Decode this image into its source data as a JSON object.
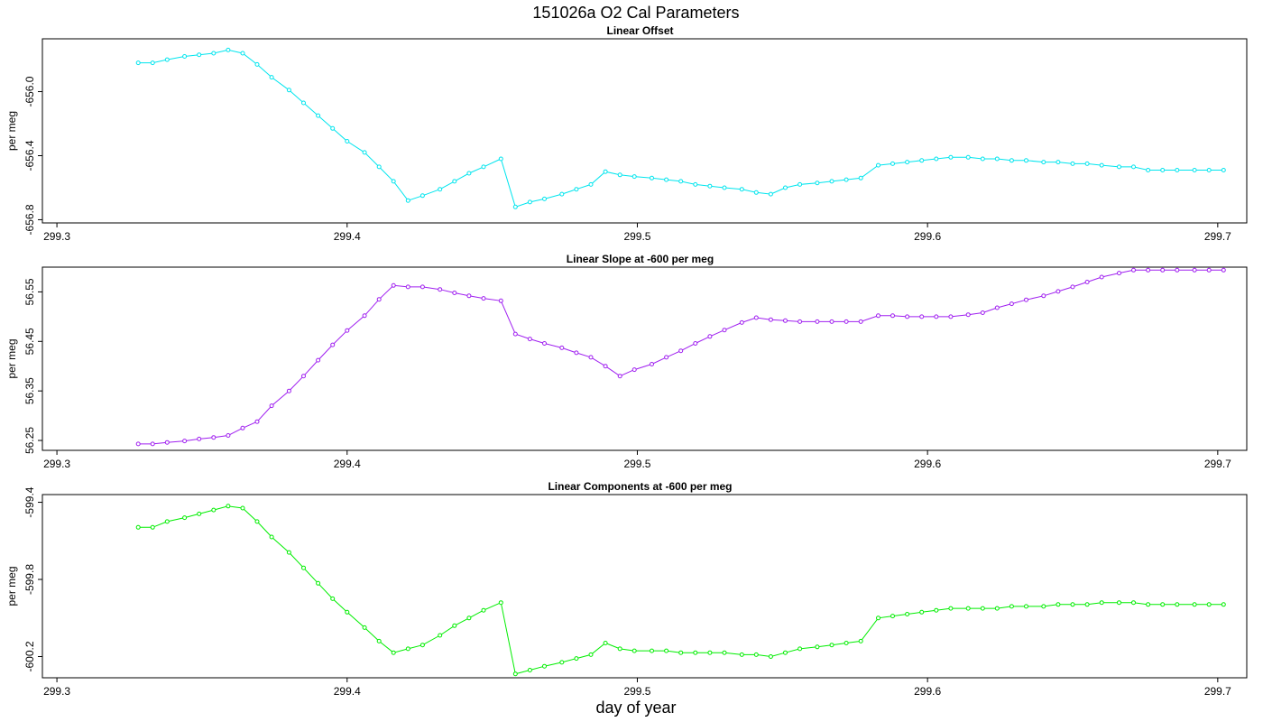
{
  "figure": {
    "title": "151026a   O2 Cal Parameters",
    "xlabel": "day of year"
  },
  "chart_data": [
    {
      "type": "line",
      "title": "Linear Offset",
      "ylabel": "per meg",
      "xlabel": "",
      "color": "#00e5ee",
      "xlim": [
        299.295,
        299.71
      ],
      "ylim": [
        -656.82,
        -655.67
      ],
      "xticks": [
        299.3,
        299.4,
        299.5,
        299.6,
        299.7
      ],
      "xtick_labels": [
        "299.3",
        "299.4",
        "299.5",
        "299.6",
        "299.7"
      ],
      "yticks": [
        -656.0,
        -656.4,
        -656.8
      ],
      "ytick_labels": [
        "-656.0",
        "-656.4",
        "-656.8"
      ],
      "x": [
        299.328,
        299.333,
        299.338,
        299.344,
        299.349,
        299.354,
        299.359,
        299.364,
        299.369,
        299.374,
        299.38,
        299.385,
        299.39,
        299.395,
        299.4,
        299.406,
        299.411,
        299.416,
        299.421,
        299.426,
        299.432,
        299.437,
        299.442,
        299.447,
        299.453,
        299.458,
        299.463,
        299.468,
        299.474,
        299.479,
        299.484,
        299.489,
        299.494,
        299.499,
        299.505,
        299.51,
        299.515,
        299.52,
        299.525,
        299.53,
        299.536,
        299.541,
        299.546,
        299.551,
        299.556,
        299.562,
        299.567,
        299.572,
        299.577,
        299.583,
        299.588,
        299.593,
        299.598,
        299.603,
        299.608,
        299.614,
        299.619,
        299.624,
        299.629,
        299.634,
        299.64,
        299.645,
        299.65,
        299.655,
        299.66,
        299.666,
        299.671,
        299.676,
        299.681,
        299.686,
        299.692,
        299.697,
        299.702
      ],
      "y": [
        -655.82,
        -655.82,
        -655.8,
        -655.78,
        -655.77,
        -655.76,
        -655.74,
        -655.76,
        -655.83,
        -655.91,
        -655.99,
        -656.07,
        -656.15,
        -656.23,
        -656.31,
        -656.38,
        -656.47,
        -656.56,
        -656.68,
        -656.65,
        -656.61,
        -656.56,
        -656.51,
        -656.47,
        -656.42,
        -656.72,
        -656.69,
        -656.67,
        -656.64,
        -656.61,
        -656.58,
        -656.5,
        -656.52,
        -656.53,
        -656.54,
        -656.55,
        -656.56,
        -656.58,
        -656.59,
        -656.6,
        -656.61,
        -656.63,
        -656.64,
        -656.6,
        -656.58,
        -656.57,
        -656.56,
        -656.55,
        -656.54,
        -656.46,
        -656.45,
        -656.44,
        -656.43,
        -656.42,
        -656.41,
        -656.41,
        -656.42,
        -656.42,
        -656.43,
        -656.43,
        -656.44,
        -656.44,
        -656.45,
        -656.45,
        -656.46,
        -656.47,
        -656.47,
        -656.49,
        -656.49,
        -656.49,
        -656.49,
        -656.49,
        -656.49
      ]
    },
    {
      "type": "line",
      "title": "Linear Slope at -600 per meg",
      "ylabel": "per meg",
      "xlabel": "",
      "color": "#a020f0",
      "xlim": [
        299.295,
        299.71
      ],
      "ylim": [
        56.23,
        56.6
      ],
      "xticks": [
        299.3,
        299.4,
        299.5,
        299.6,
        299.7
      ],
      "xtick_labels": [
        "299.3",
        "299.4",
        "299.5",
        "299.6",
        "299.7"
      ],
      "yticks": [
        56.25,
        56.35,
        56.45,
        56.55
      ],
      "ytick_labels": [
        "56.25",
        "56.35",
        "56.45",
        "56.55"
      ],
      "x": [
        299.328,
        299.333,
        299.338,
        299.344,
        299.349,
        299.354,
        299.359,
        299.364,
        299.369,
        299.374,
        299.38,
        299.385,
        299.39,
        299.395,
        299.4,
        299.406,
        299.411,
        299.416,
        299.421,
        299.426,
        299.432,
        299.437,
        299.442,
        299.447,
        299.453,
        299.458,
        299.463,
        299.468,
        299.474,
        299.479,
        299.484,
        299.489,
        299.494,
        299.499,
        299.505,
        299.51,
        299.515,
        299.52,
        299.525,
        299.53,
        299.536,
        299.541,
        299.546,
        299.551,
        299.556,
        299.562,
        299.567,
        299.572,
        299.577,
        299.583,
        299.588,
        299.593,
        299.598,
        299.603,
        299.608,
        299.614,
        299.619,
        299.624,
        299.629,
        299.634,
        299.64,
        299.645,
        299.65,
        299.655,
        299.66,
        299.666,
        299.671,
        299.676,
        299.681,
        299.686,
        299.692,
        299.697,
        299.702
      ],
      "y": [
        56.243,
        56.243,
        56.246,
        56.249,
        56.253,
        56.256,
        56.26,
        56.275,
        56.288,
        56.32,
        56.35,
        56.38,
        56.412,
        56.443,
        56.472,
        56.502,
        56.535,
        56.563,
        56.56,
        56.56,
        56.555,
        56.548,
        56.542,
        56.537,
        56.532,
        56.465,
        56.455,
        56.446,
        56.437,
        56.427,
        56.418,
        56.4,
        56.38,
        56.393,
        56.404,
        56.418,
        56.431,
        56.446,
        56.46,
        56.473,
        56.488,
        56.498,
        56.494,
        56.492,
        56.49,
        56.49,
        56.49,
        56.49,
        56.49,
        56.502,
        56.502,
        56.5,
        56.5,
        56.5,
        56.5,
        56.504,
        56.508,
        56.518,
        56.526,
        56.534,
        56.542,
        56.551,
        56.56,
        56.57,
        56.58,
        56.588,
        56.594,
        56.594,
        56.594,
        56.594,
        56.594,
        56.594,
        56.594
      ]
    },
    {
      "type": "line",
      "title": "Linear Components at -600 per meg",
      "ylabel": "per meg",
      "xlabel": "day of year",
      "color": "#00ee00",
      "xlim": [
        299.295,
        299.71
      ],
      "ylim": [
        -600.31,
        -599.36
      ],
      "xticks": [
        299.3,
        299.4,
        299.5,
        299.6,
        299.7
      ],
      "xtick_labels": [
        "299.3",
        "299.4",
        "299.5",
        "299.6",
        "299.7"
      ],
      "yticks": [
        -599.4,
        -599.8,
        -600.2
      ],
      "ytick_labels": [
        "-599.4",
        "-599.8",
        "-600.2"
      ],
      "x": [
        299.328,
        299.333,
        299.338,
        299.344,
        299.349,
        299.354,
        299.359,
        299.364,
        299.369,
        299.374,
        299.38,
        299.385,
        299.39,
        299.395,
        299.4,
        299.406,
        299.411,
        299.416,
        299.421,
        299.426,
        299.432,
        299.437,
        299.442,
        299.447,
        299.453,
        299.458,
        299.463,
        299.468,
        299.474,
        299.479,
        299.484,
        299.489,
        299.494,
        299.499,
        299.505,
        299.51,
        299.515,
        299.52,
        299.525,
        299.53,
        299.536,
        299.541,
        299.546,
        299.551,
        299.556,
        299.562,
        299.567,
        299.572,
        299.577,
        299.583,
        299.588,
        299.593,
        299.598,
        299.603,
        299.608,
        299.614,
        299.619,
        299.624,
        299.629,
        299.634,
        299.64,
        299.645,
        299.65,
        299.655,
        299.66,
        299.666,
        299.671,
        299.676,
        299.681,
        299.686,
        299.692,
        299.697,
        299.702
      ],
      "y": [
        -599.53,
        -599.53,
        -599.5,
        -599.48,
        -599.46,
        -599.44,
        -599.42,
        -599.43,
        -599.5,
        -599.58,
        -599.66,
        -599.74,
        -599.82,
        -599.9,
        -599.97,
        -600.05,
        -600.12,
        -600.18,
        -600.16,
        -600.14,
        -600.09,
        -600.04,
        -600.0,
        -599.96,
        -599.92,
        -600.29,
        -600.27,
        -600.25,
        -600.23,
        -600.21,
        -600.19,
        -600.13,
        -600.16,
        -600.17,
        -600.17,
        -600.17,
        -600.18,
        -600.18,
        -600.18,
        -600.18,
        -600.19,
        -600.19,
        -600.2,
        -600.18,
        -600.16,
        -600.15,
        -600.14,
        -600.13,
        -600.12,
        -600.0,
        -599.99,
        -599.98,
        -599.97,
        -599.96,
        -599.95,
        -599.95,
        -599.95,
        -599.95,
        -599.94,
        -599.94,
        -599.94,
        -599.93,
        -599.93,
        -599.93,
        -599.92,
        -599.92,
        -599.92,
        -599.93,
        -599.93,
        -599.93,
        -599.93,
        -599.93,
        -599.93
      ]
    }
  ]
}
